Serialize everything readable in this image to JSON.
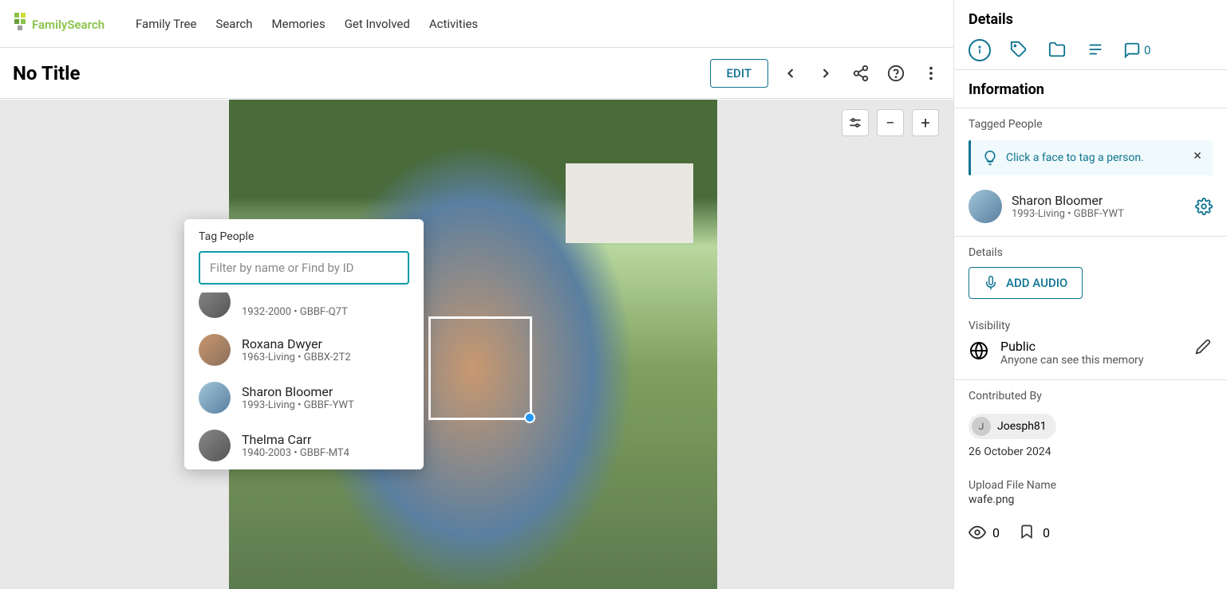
{
  "nav": {
    "links": [
      "Family Tree",
      "Search",
      "Memories",
      "Get Involved",
      "Activities"
    ],
    "user": "Joesph81"
  },
  "toolbar": {
    "title": "No Title",
    "edit": "EDIT"
  },
  "tagPopup": {
    "title": "Tag People",
    "placeholder": "Filter by name or Find by ID",
    "people": [
      {
        "name": "",
        "meta": "1932-2000 • GBBF-Q7T",
        "avatar": "gray",
        "partial": true
      },
      {
        "name": "Roxana Dwyer",
        "meta": "1963-Living • GBBX-2T2",
        "avatar": "tan"
      },
      {
        "name": "Sharon Bloomer",
        "meta": "1993-Living • GBBF-YWT",
        "avatar": "blue"
      },
      {
        "name": "Thelma Carr",
        "meta": "1940-2003 • GBBF-MT4",
        "avatar": "gray"
      }
    ]
  },
  "details": {
    "header": "Details",
    "commentCount": "0",
    "infoTitle": "Information",
    "taggedLabel": "Tagged People",
    "tip": "Click a face to tag a person.",
    "tagged": {
      "name": "Sharon Bloomer",
      "lifespan": "1993-Living",
      "id": "GBBF-YWT"
    },
    "detailsLabel": "Details",
    "addAudio": "ADD AUDIO",
    "visibilityLabel": "Visibility",
    "visibility": {
      "title": "Public",
      "desc": "Anyone can see this memory"
    },
    "contribLabel": "Contributed By",
    "contrib": {
      "name": "Joesph81",
      "initial": "J",
      "date": "26 October 2024"
    },
    "uploadLabel": "Upload File Name",
    "uploadName": "wafe.png",
    "views": "0",
    "bookmarks": "0"
  }
}
